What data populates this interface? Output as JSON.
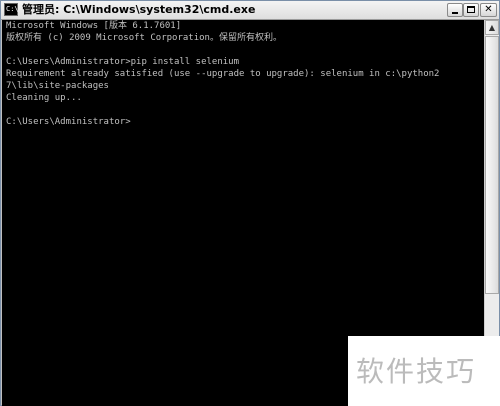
{
  "window": {
    "title": "管理员: C:\\Windows\\system32\\cmd.exe",
    "icon": "cmd-icon",
    "minimize_glyph": "_",
    "maximize_glyph": "□",
    "close_glyph": "✕"
  },
  "console": {
    "text_color": "#c0c0c0",
    "background": "#000000",
    "lines": [
      "Microsoft Windows [版本 6.1.7601]",
      "版权所有 (c) 2009 Microsoft Corporation。保留所有权利。",
      "",
      "C:\\Users\\Administrator>pip install selenium",
      "Requirement already satisfied (use --upgrade to upgrade): selenium in c:\\python2",
      "7\\lib\\site-packages",
      "Cleaning up...",
      "",
      "C:\\Users\\Administrator>"
    ]
  },
  "scrollbar": {
    "up_glyph": "▲",
    "down_glyph": "▼"
  },
  "watermark": {
    "text": "软件技巧"
  }
}
